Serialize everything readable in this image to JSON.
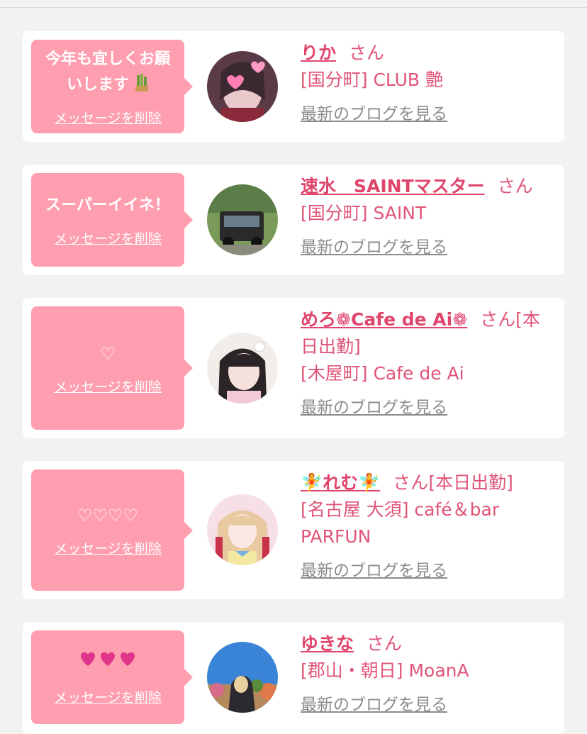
{
  "delete_label": "メッセージを削除",
  "blog_label": "最新のブログを見る",
  "san_suffix": "さん",
  "entries": [
    {
      "message_line1": "今年も宜しくお願",
      "message_line2": "いします",
      "name": "りか",
      "status": "",
      "shop": "[国分町] CLUB 艶"
    },
    {
      "message_line1": "スーパーイイネ！",
      "message_line2": "",
      "name": "速水　SAINTマスター",
      "status": "",
      "shop": "[国分町] SAINT"
    },
    {
      "message_line1": "♡",
      "message_line2": "",
      "name": "めろ",
      "name_suffix": "Cafe de Ai",
      "status": "[本日出勤]",
      "shop": "[木屋町] Cafe de Ai"
    },
    {
      "message_line1": "♡♡♡♡",
      "message_line2": "",
      "name": "れむ",
      "status": "[本日出勤]",
      "shop_line1": "[名古屋 大須] café＆bar",
      "shop_line2": "PARFUN"
    },
    {
      "message_line1": "",
      "message_line2": "",
      "name": "ゆきな",
      "status": "",
      "shop": "[郡山・朝日] MoanA"
    }
  ],
  "colors": {
    "bubble": "#ff9eaf",
    "name": "#e0456b",
    "text": "#e05577",
    "link": "#8c8c8c",
    "background": "#f2f2f2"
  }
}
